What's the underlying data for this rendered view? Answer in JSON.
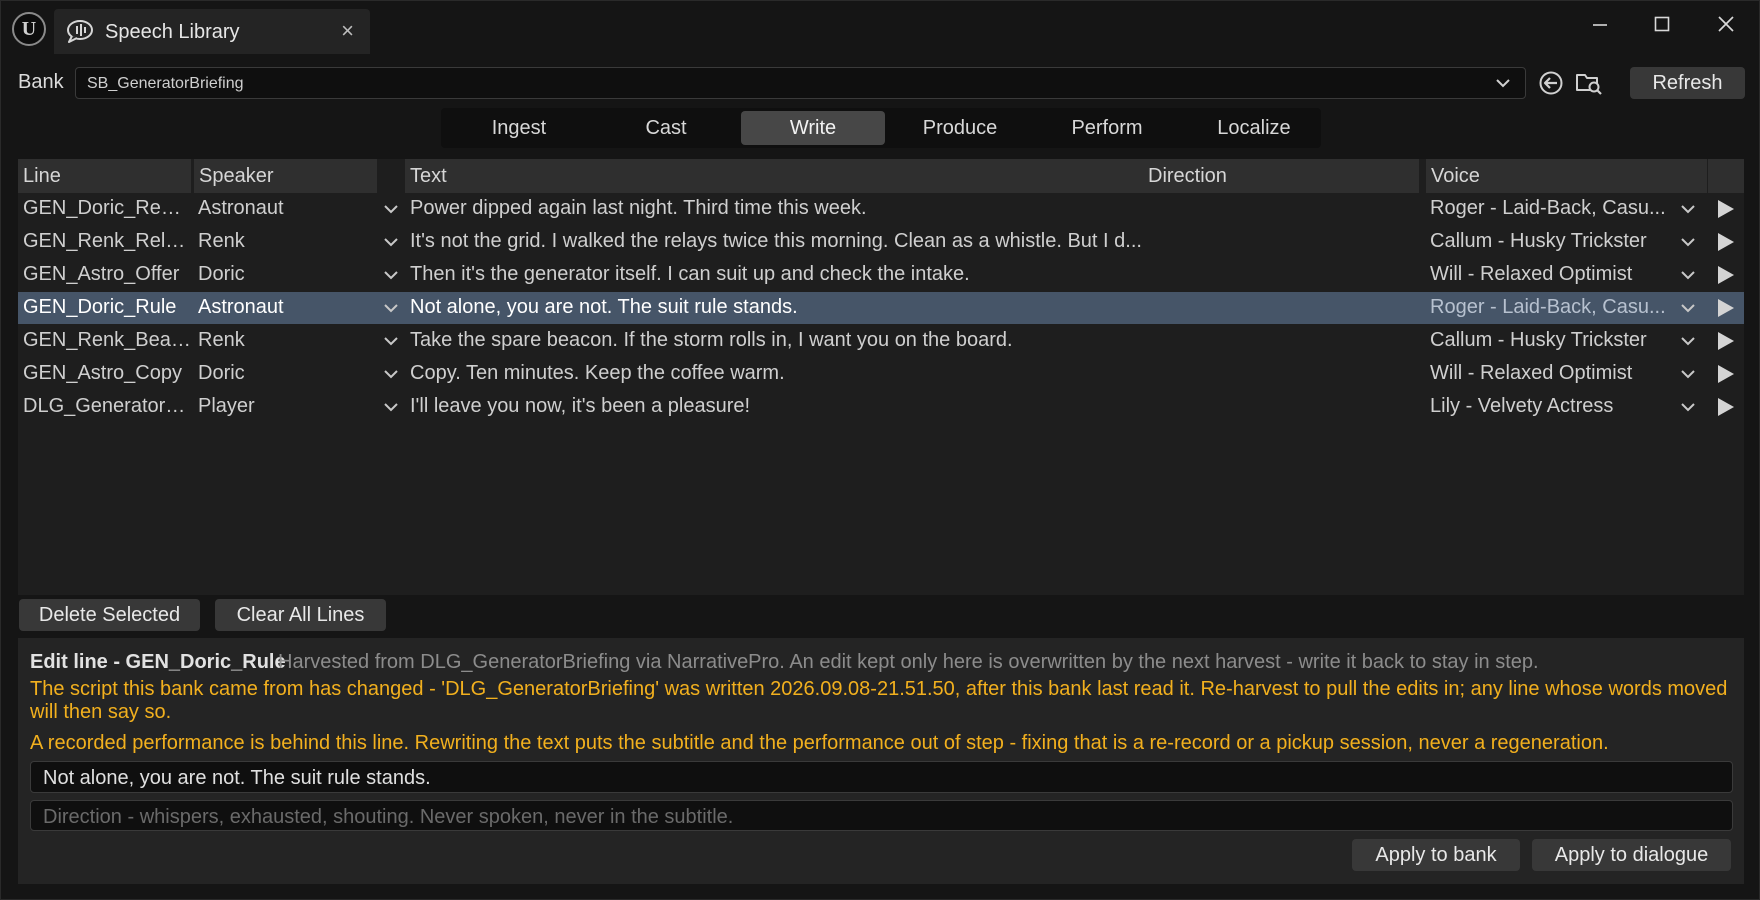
{
  "window": {
    "title": "Speech Library",
    "close_glyph": "×"
  },
  "bank": {
    "label": "Bank",
    "value": "SB_GeneratorBriefing",
    "refresh_label": "Refresh"
  },
  "mode_tabs": [
    {
      "label": "Ingest",
      "active": false
    },
    {
      "label": "Cast",
      "active": false
    },
    {
      "label": "Write",
      "active": true
    },
    {
      "label": "Produce",
      "active": false
    },
    {
      "label": "Perform",
      "active": false
    },
    {
      "label": "Localize",
      "active": false
    }
  ],
  "table": {
    "columns": [
      "Line",
      "Speaker",
      "Text",
      "Direction",
      "Voice"
    ],
    "rows": [
      {
        "line": "GEN_Doric_Report",
        "speaker": "Astronaut",
        "text": "Power dipped again last night. Third time this week.",
        "direction": "",
        "voice": "Roger - Laid-Back, Casu...",
        "selected": false
      },
      {
        "line": "GEN_Renk_Relays",
        "speaker": "Renk",
        "text": "It's not the grid. I walked the relays twice this morning. Clean as a whistle. But I d...",
        "direction": "",
        "voice": "Callum - Husky Trickster",
        "selected": false
      },
      {
        "line": "GEN_Astro_Offer",
        "speaker": "Doric",
        "text": "Then it's the generator itself. I can suit up and check the intake.",
        "direction": "",
        "voice": "Will - Relaxed Optimist",
        "selected": false
      },
      {
        "line": "GEN_Doric_Rule",
        "speaker": "Astronaut",
        "text": "Not alone, you are not. The suit rule stands.",
        "direction": "",
        "voice": "Roger - Laid-Back, Casu...",
        "selected": true
      },
      {
        "line": "GEN_Renk_Beacon",
        "speaker": "Renk",
        "text": "Take the spare beacon. If the storm rolls in, I want you on the board.",
        "direction": "",
        "voice": "Callum - Husky Trickster",
        "selected": false
      },
      {
        "line": "GEN_Astro_Copy",
        "speaker": "Doric",
        "text": "Copy. Ten minutes. Keep the coffee warm.",
        "direction": "",
        "voice": "Will - Relaxed Optimist",
        "selected": false
      },
      {
        "line": "DLG_GeneratorBr...",
        "speaker": "Player",
        "text": "I'll leave you now, it's been a pleasure!",
        "direction": "",
        "voice": "Lily - Velvety Actress",
        "selected": false
      }
    ]
  },
  "actions": {
    "delete_label": "Delete Selected",
    "clear_label": "Clear All Lines"
  },
  "edit": {
    "title": "Edit line - GEN_Doric_Rule",
    "note": "Harvested from DLG_GeneratorBriefing via NarrativePro. An edit kept only here is overwritten by the next harvest - write it back to stay in step.",
    "warning_script": "The script this bank came from has changed - 'DLG_GeneratorBriefing' was written 2026.09.08-21.51.50, after this bank last read it. Re-harvest to pull the edits in; any line whose words moved will then say so.",
    "warning_performance": "A recorded performance is behind this line. Rewriting the text puts the subtitle and the performance out of step - fixing that is a re-record or a pickup session, never a regeneration.",
    "text_value": "Not alone, you are not. The suit rule stands.",
    "direction_placeholder": "Direction - whispers, exhausted, shouting. Never spoken, never in the subtitle.",
    "apply_bank_label": "Apply to bank",
    "apply_dialogue_label": "Apply to dialogue"
  },
  "colors": {
    "background": "#151515",
    "panel": "#242424",
    "selection": "#465568",
    "warning": "#f2b01e"
  }
}
